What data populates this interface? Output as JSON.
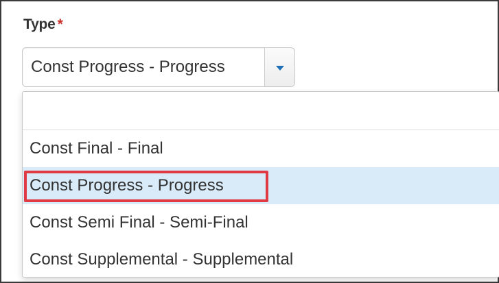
{
  "field": {
    "label": "Type",
    "required_mark": "*"
  },
  "select": {
    "current_value": "Const Progress - Progress"
  },
  "dropdown": {
    "search_value": "",
    "search_placeholder": "",
    "options": [
      {
        "label": "Const Final - Final"
      },
      {
        "label": "Const Progress - Progress",
        "selected": true,
        "annotated": true
      },
      {
        "label": "Const Semi Final - Semi-Final"
      },
      {
        "label": "Const Supplemental - Supplemental"
      }
    ]
  },
  "colors": {
    "required_star": "#c9302c",
    "caret": "#1f6fb5",
    "selected_row": "#d9eaf8",
    "annotation_box": "#e03a44"
  },
  "icons": {
    "toggle": "chevron-down-icon"
  }
}
